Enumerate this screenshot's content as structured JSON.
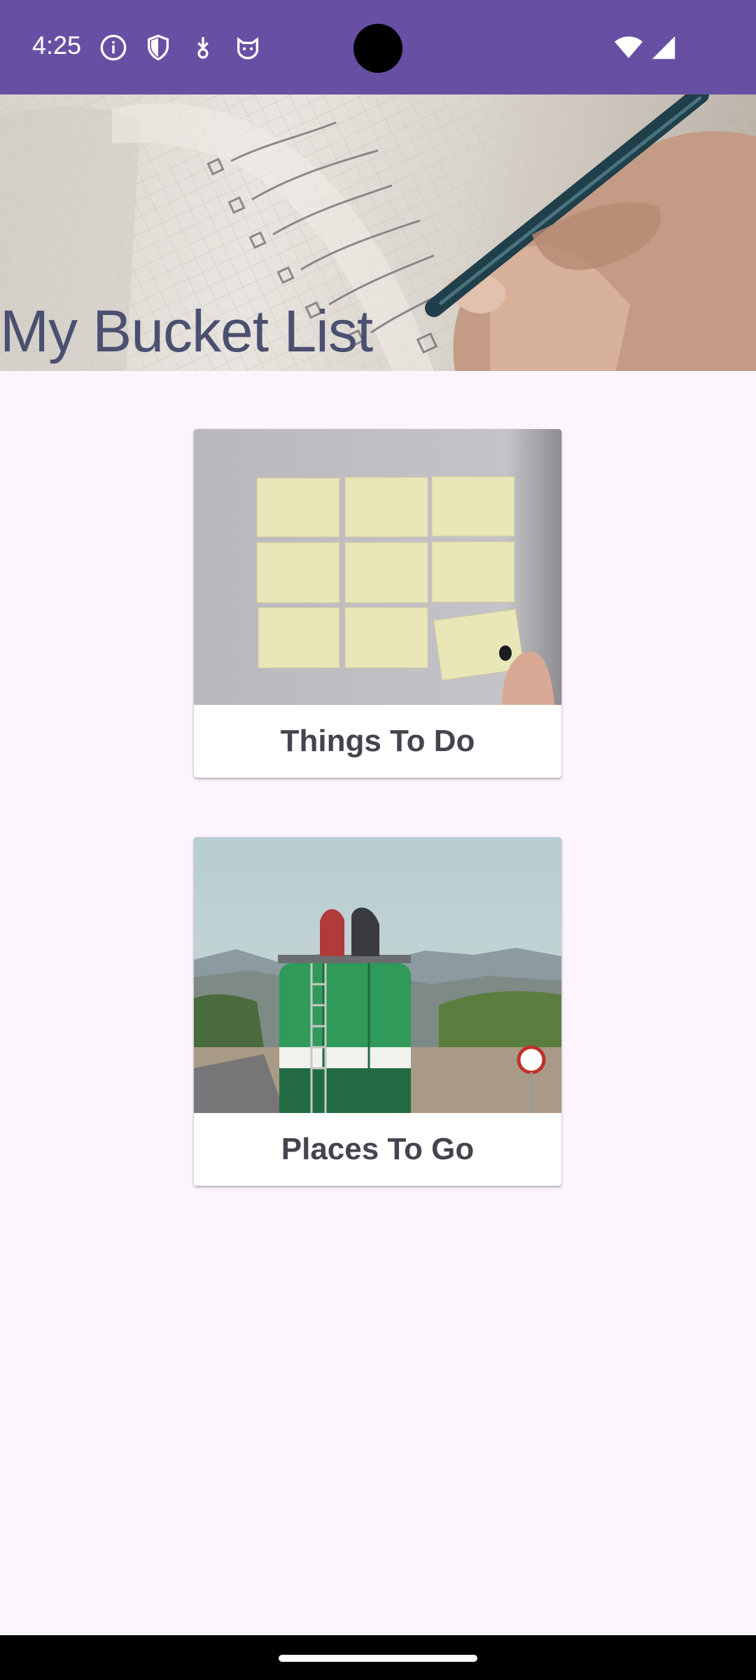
{
  "status_bar": {
    "time": "4:25",
    "icons_left": [
      "info-icon",
      "shield-icon",
      "download-icon",
      "cat-face-icon"
    ],
    "icons_right": [
      "wifi-icon",
      "cellular-signal-icon"
    ],
    "background": "#6750a4"
  },
  "header": {
    "title": "My Bucket List",
    "title_color": "#4b5070"
  },
  "cards": [
    {
      "label": "Things To Do",
      "image": "sticky-notes-photo"
    },
    {
      "label": "Places To Go",
      "image": "green-van-road-photo"
    }
  ],
  "colors": {
    "page_background": "#fcf5fd",
    "card_text": "#45444e",
    "accent": "#6750a4"
  }
}
